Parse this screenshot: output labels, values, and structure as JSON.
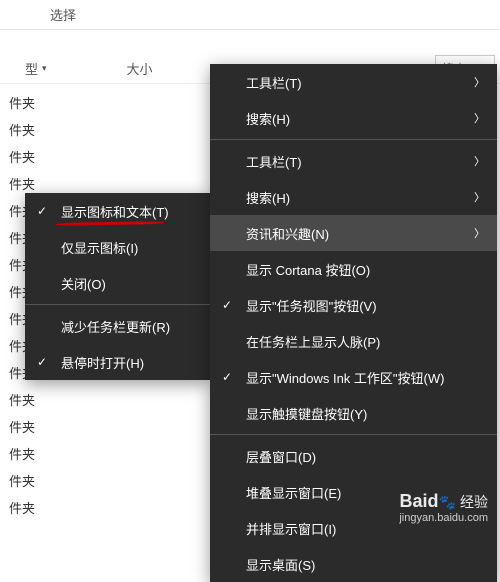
{
  "toolbar": {
    "select_label": "选择"
  },
  "header": {
    "col_type": "型",
    "col_size": "大小",
    "search_placeholder": "搜索\"W"
  },
  "file_label": "件夹",
  "menu_a": {
    "show_icon_text": "显示图标和文本(T)",
    "show_icon_only": "仅显示图标(I)",
    "close": "关闭(O)",
    "reduce_updates": "减少任务栏更新(R)",
    "open_on_hover": "悬停时打开(H)"
  },
  "menu_b": {
    "toolbars1": "工具栏(T)",
    "search1": "搜索(H)",
    "toolbars2": "工具栏(T)",
    "search2": "搜索(H)",
    "news_interests": "资讯和兴趣(N)",
    "cortana": "显示 Cortana 按钮(O)",
    "task_view": "显示\"任务视图\"按钮(V)",
    "people": "在任务栏上显示人脉(P)",
    "ink": "显示\"Windows Ink 工作区\"按钮(W)",
    "touch_kb": "显示触摸键盘按钮(Y)",
    "cascade": "层叠窗口(D)",
    "stacked": "堆叠显示窗口(E)",
    "side_by_side": "并排显示窗口(I)",
    "show_desktop": "显示桌面(S)"
  },
  "watermark": {
    "brand": "Baid",
    "sub": "经验",
    "url": "jingyan.baidu.com"
  }
}
